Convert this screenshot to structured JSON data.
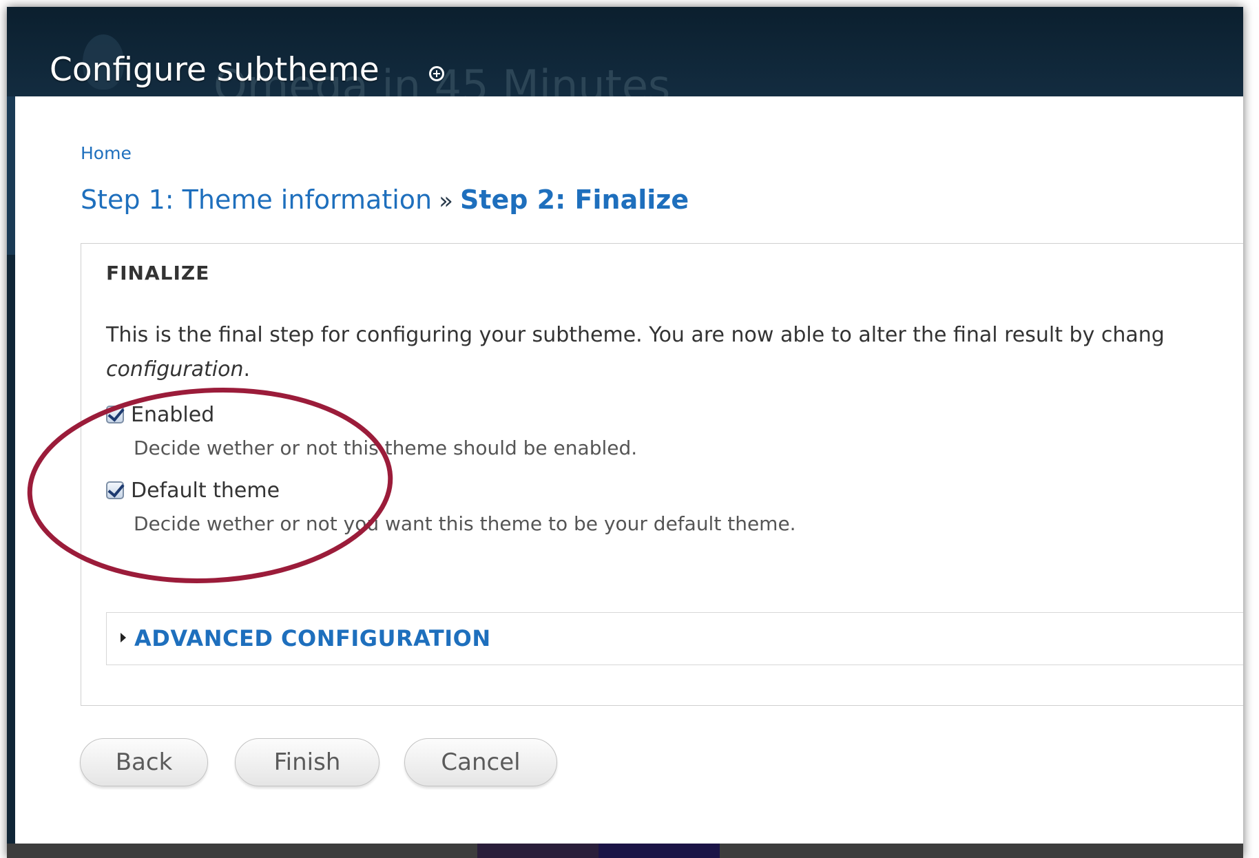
{
  "background": {
    "ghost_title": "Omega in 45 Minutes"
  },
  "modal": {
    "title": "Configure subtheme",
    "title_icon": "plus-circle-icon"
  },
  "breadcrumb": {
    "home": "Home"
  },
  "steps": {
    "step1": "Step 1: Theme information",
    "separator": "»",
    "step2": "Step 2: Finalize"
  },
  "finalize": {
    "legend": "FINALIZE",
    "description_main": "This is the final step for configuring your subtheme. You are now able to alter the final result by chang",
    "description_em": "configuration",
    "description_end": ".",
    "enabled": {
      "label": "Enabled",
      "checked": true,
      "help": "Decide wether or not this theme should be enabled."
    },
    "default_theme": {
      "label": "Default theme",
      "checked": true,
      "help": "Decide wether or not you want this theme to be your default theme."
    },
    "advanced": {
      "title": "ADVANCED CONFIGURATION",
      "collapsed": true
    }
  },
  "buttons": {
    "back": "Back",
    "finish": "Finish",
    "cancel": "Cancel"
  },
  "colors": {
    "link_blue": "#1e6fbd",
    "header_dark": "#0f2536",
    "annotation_red": "#9b1c3a"
  }
}
